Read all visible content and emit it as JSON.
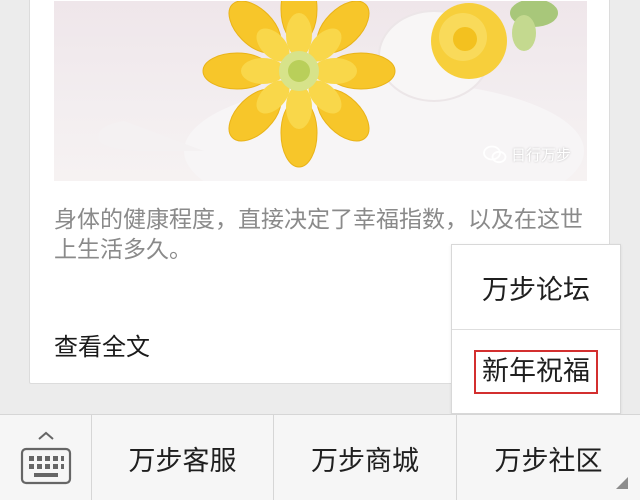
{
  "article": {
    "watermark": "日行万步",
    "summary": "身体的健康程度，直接决定了幸福指数，以及在这世上生活多久。",
    "read_more": "查看全文"
  },
  "popup": {
    "items": [
      {
        "label": "万步论坛"
      },
      {
        "label": "新年祝福"
      }
    ],
    "highlight_color": "#d32f2f"
  },
  "menubar": {
    "keyboard_icon": "keyboard-icon",
    "buttons": [
      {
        "label": "万步客服"
      },
      {
        "label": "万步商城"
      },
      {
        "label": "万步社区"
      }
    ]
  },
  "colors": {
    "background": "#ececec",
    "card": "#ffffff",
    "summary_text": "#8a8a8a",
    "flower": "#f7c62a"
  }
}
